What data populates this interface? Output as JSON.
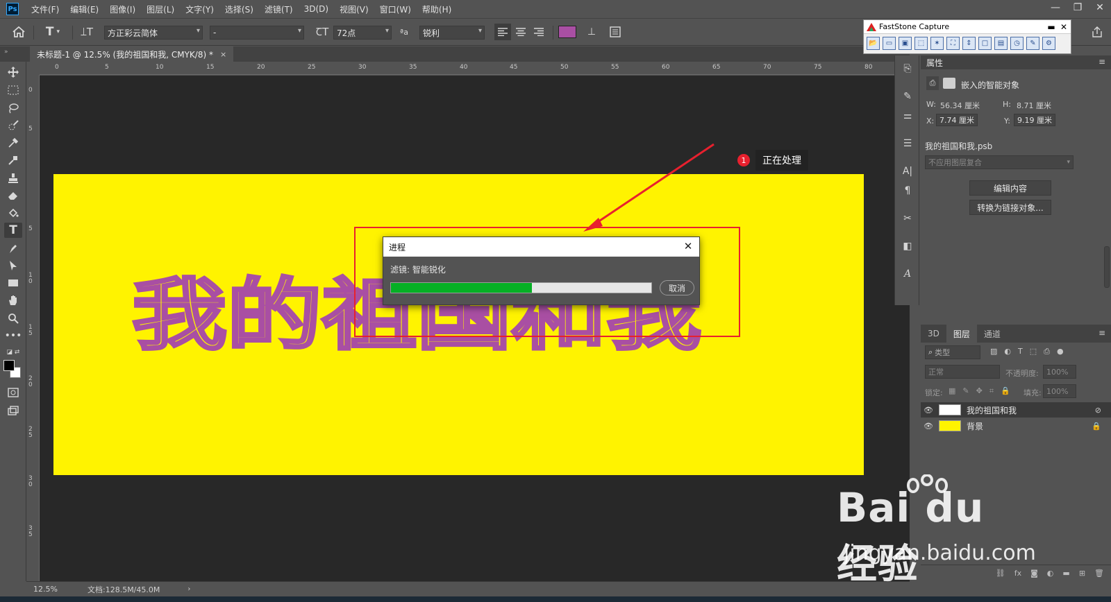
{
  "menubar": {
    "logo": "Ps",
    "items": [
      "文件(F)",
      "编辑(E)",
      "图像(I)",
      "图层(L)",
      "文字(Y)",
      "选择(S)",
      "滤镜(T)",
      "3D(D)",
      "视图(V)",
      "窗口(W)",
      "帮助(H)"
    ]
  },
  "options": {
    "font_family": "方正彩云简体",
    "font_style": "-",
    "font_size": "72点",
    "aa_label": "ªa",
    "antialias": "锐利",
    "text_color": "#a94fa3"
  },
  "tab": {
    "title": "未标题-1 @ 12.5% (我的祖国和我, CMYK/8) *",
    "close": "×"
  },
  "ruler": {
    "h_ticks": [
      "0",
      "5",
      "10",
      "15",
      "20",
      "25",
      "30",
      "35",
      "40",
      "45",
      "50",
      "55",
      "60",
      "65",
      "70",
      "75",
      "80"
    ],
    "v_ticks": [
      "0",
      "5",
      "1\n0",
      "5",
      "1\n5",
      "2\n0",
      "2\n5",
      "3\n0",
      "3\n5"
    ]
  },
  "canvas": {
    "artboard_color": "#fff300",
    "art_text": "我的祖国和我",
    "art_outline_color": "#a94fa3"
  },
  "status": {
    "zoom": "12.5%",
    "doc": "文档:128.5M/45.0M"
  },
  "annotation": {
    "badge": "1",
    "label": "正在处理",
    "color": "#e8202e"
  },
  "dialog": {
    "title": "进程",
    "message": "滤镜: 智能锐化",
    "progress": 0.54,
    "cancel": "取消"
  },
  "faststone": {
    "title": "FastStone Capture"
  },
  "properties": {
    "title": "属性",
    "object_type": "嵌入的智能对象",
    "w_label": "W:",
    "w": "56.34 厘米",
    "h_label": "H:",
    "h": "8.71 厘米",
    "x_label": "X:",
    "x": "7.74 厘米",
    "y_label": "Y:",
    "y": "9.19 厘米",
    "file": "我的祖国和我.psb",
    "comp": "不应用图层复合",
    "edit_btn": "编辑内容",
    "convert_btn": "转换为链接对象..."
  },
  "layers": {
    "tabs": [
      "3D",
      "图层",
      "通道"
    ],
    "filter_placeholder": "类型",
    "blend": "正常",
    "opacity_label": "不透明度:",
    "opacity": "100%",
    "lock_label": "锁定:",
    "fill_label": "填充:",
    "fill": "100%",
    "items": [
      {
        "name": "我的祖国和我"
      },
      {
        "name": "背景"
      }
    ]
  },
  "watermark": {
    "main": "Bai du 经验",
    "sub": "jingyan.baidu.com"
  }
}
